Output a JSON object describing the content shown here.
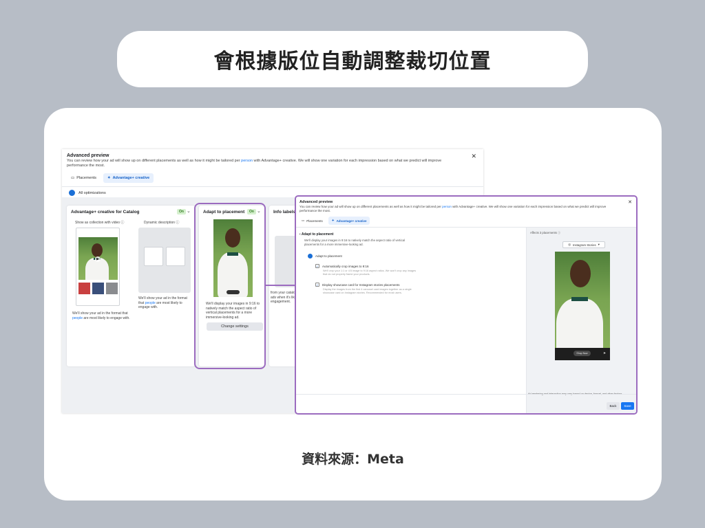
{
  "heading": "會根據版位自動調整裁切位置",
  "source": "資料來源：Meta",
  "back_panel": {
    "title": "Advanced preview",
    "desc_before": "You can review how your ad will show up on different placements as well as how it might be tailored per ",
    "desc_link": "person",
    "desc_after": " with Advantage+ creative. We will show one variation for each impression based on what we predict will improve performance the most.",
    "tabs": [
      {
        "label": "Placements",
        "icon": "placements-icon",
        "active": false
      },
      {
        "label": "Advantage+ creative",
        "icon": "sparkle-icon",
        "active": true
      }
    ],
    "all_optimizations": "All optimizations",
    "catalog_card": {
      "title": "Advantage+ creative for Catalog",
      "badge": "On",
      "col1_label": "Show as collection with video",
      "col2_label": "Dynamic description",
      "text1_before": "We'll show your ad in the format that ",
      "text1_link": "people",
      "text1_after": " are most likely to engage with.",
      "text2_before": "We'll show your ad in the format that ",
      "text2_link": "people",
      "text2_after": " are most likely to engage with."
    },
    "adapt_card": {
      "title": "Adapt to placement",
      "badge": "On",
      "text": "We'll display your images in 9:16 to natively match the aspect ratio of vertical placements for a more immersive-looking ad.",
      "button": "Change settings"
    },
    "info_card": {
      "title": "Info labels",
      "text": "from your catalo ads when it's lik engagement."
    }
  },
  "front_panel": {
    "title": "Advanced preview",
    "desc_before": "You can review how your ad will show up on different placements as well as how it might be tailored per ",
    "desc_link": "person",
    "desc_after": " with Advantage+ creative. We will show one variation for each impression based on what we predict will improve performance the most.",
    "tabs": [
      {
        "label": "Placements",
        "active": false
      },
      {
        "label": "Advantage+ creative",
        "active": true
      }
    ],
    "section_title": "Adapt to placement",
    "section_desc": "We'll display your images in 9:16 to natively match the aspect ratio of vertical placements for a more immersive-looking ad.",
    "toggle_label": "Adapt to placement",
    "option1": "Automatically crop images to 9:16",
    "option1_sub": "We'll crop your 1:1 or 4:5 image to 9:16 aspect ratios. We won't crop any images that do not properly frame your products.",
    "option2": "Display showcase card for Instagram stories placements",
    "option2_sub": "Display the images from the first 4 carousel card images together as a single showcase card on Instagram stories. Recommended for most users.",
    "affects": "Affects 3 placements",
    "placement_select": "Instagram Stories",
    "shop_now": "Shop Now",
    "disclaimer": "Ad rendering and interaction may vary based on device, format, and other factors.",
    "back_button": "Back",
    "save_button": "Save"
  },
  "colors": {
    "background": "#b7bdc6",
    "highlight": "#9b6bbf",
    "accent": "#1877f2"
  }
}
